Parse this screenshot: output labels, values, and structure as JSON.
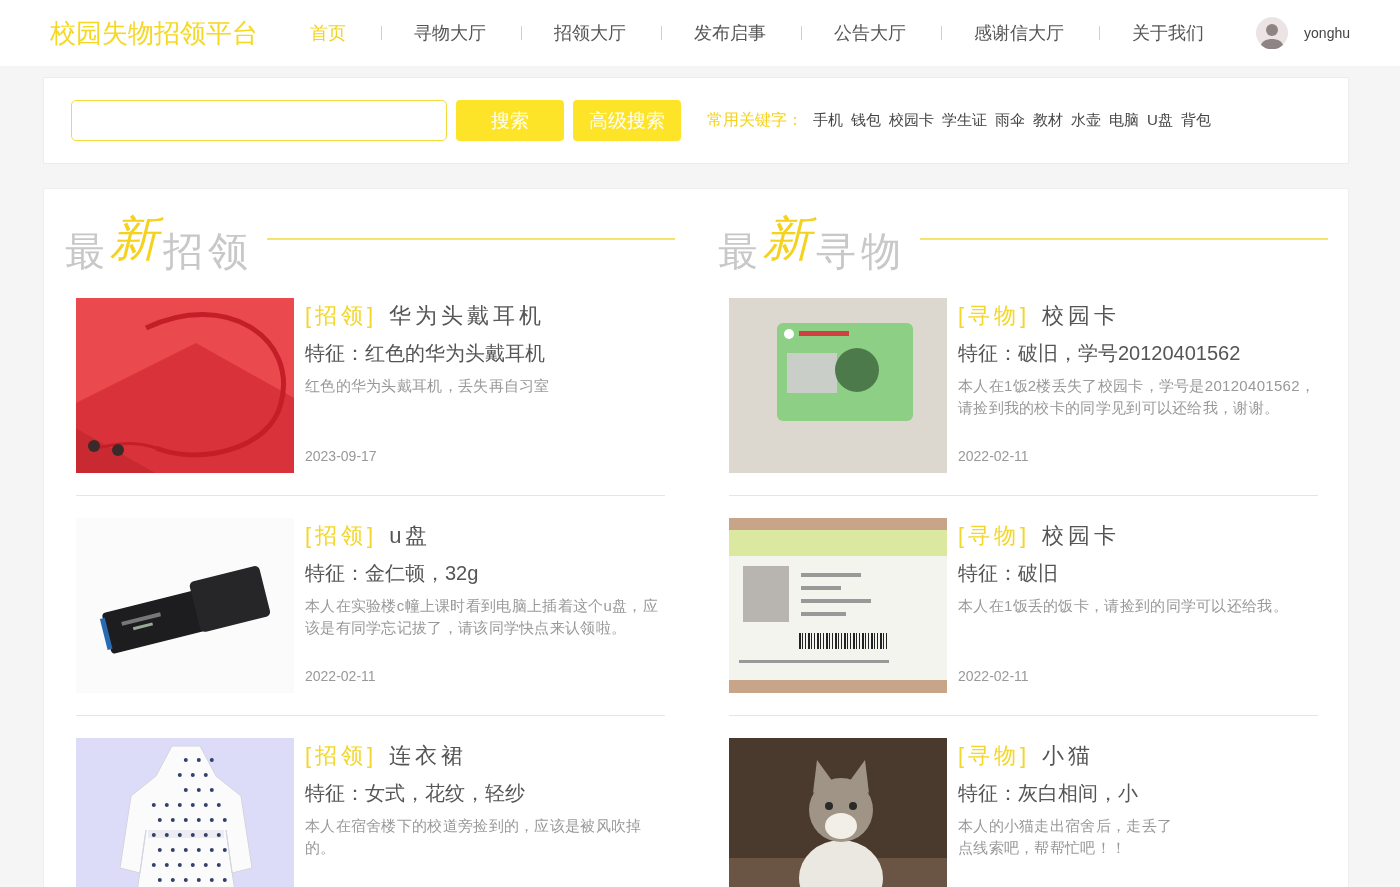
{
  "header": {
    "logo": "校园失物招领平台",
    "nav": [
      {
        "label": "首页",
        "selected": true
      },
      {
        "label": "寻物大厅",
        "selected": false
      },
      {
        "label": "招领大厅",
        "selected": false
      },
      {
        "label": "发布启事",
        "selected": false
      },
      {
        "label": "公告大厅",
        "selected": false
      },
      {
        "label": "感谢信大厅",
        "selected": false
      },
      {
        "label": "关于我们",
        "selected": false
      }
    ],
    "user": {
      "name": "yonghu"
    }
  },
  "search": {
    "buttons": [
      "搜索",
      "高级搜索"
    ],
    "keywords_label": "常用关键字：",
    "keywords": [
      "手机",
      "钱包",
      "校园卡",
      "学生证",
      "雨伞",
      "教材",
      "水壶",
      "电脑",
      "U盘",
      "背包"
    ]
  },
  "sections": [
    {
      "title": "最$^{新}$招领",
      "items": [
        {
          "kind": "headphones",
          "tag": "[招领]",
          "name": "华为头戴耳机",
          "feature": "特征：红色的华为头戴耳机",
          "description": "红色的华为头戴耳机，丢失再自习室",
          "date": "2023-09-17"
        },
        {
          "kind": "usb",
          "tag": "[招领]",
          "name": "u盘",
          "feature": "特征：金仁顿，32g",
          "description": "本人在实验楼c幢上课时看到电脑上插着这个u盘，应该是有同学忘记拔了，请该同学快点来认领啦。",
          "date": "2022-02-11"
        },
        {
          "kind": "dress",
          "tag": "[招领]",
          "name": "连衣裙",
          "feature": "特征：女式，花纹，轻纱",
          "description": "本人在宿舍楼下的校道旁捡到的，应该是被风吹掉的。"
        }
      ]
    },
    {
      "title": "最$^{新}$寻物",
      "items": [
        {
          "kind": "campuscard",
          "tag": "[寻物]",
          "name": "校园卡",
          "feature": "特征：破旧，学号20120401562",
          "description": "本人在1饭2楼丢失了校园卡，学号是20120401562，请捡到我的校卡的同学见到可以还给我，谢谢。",
          "date": "2022-02-11"
        },
        {
          "kind": "idcard",
          "tag": "[寻物]",
          "name": "校园卡",
          "feature": "特征：破旧",
          "description": "本人在1饭丢的饭卡，请捡到的同学可以还给我。",
          "date": "2022-02-11"
        },
        {
          "kind": "cat",
          "tag": "[寻物]",
          "name": "小猫",
          "feature": "特征：灰白相间，小",
          "description": "本人的小猫走出宿舍后，走丢了",
          "description_more": "点线索吧，帮帮忙吧！！"
        }
      ]
    }
  ]
}
